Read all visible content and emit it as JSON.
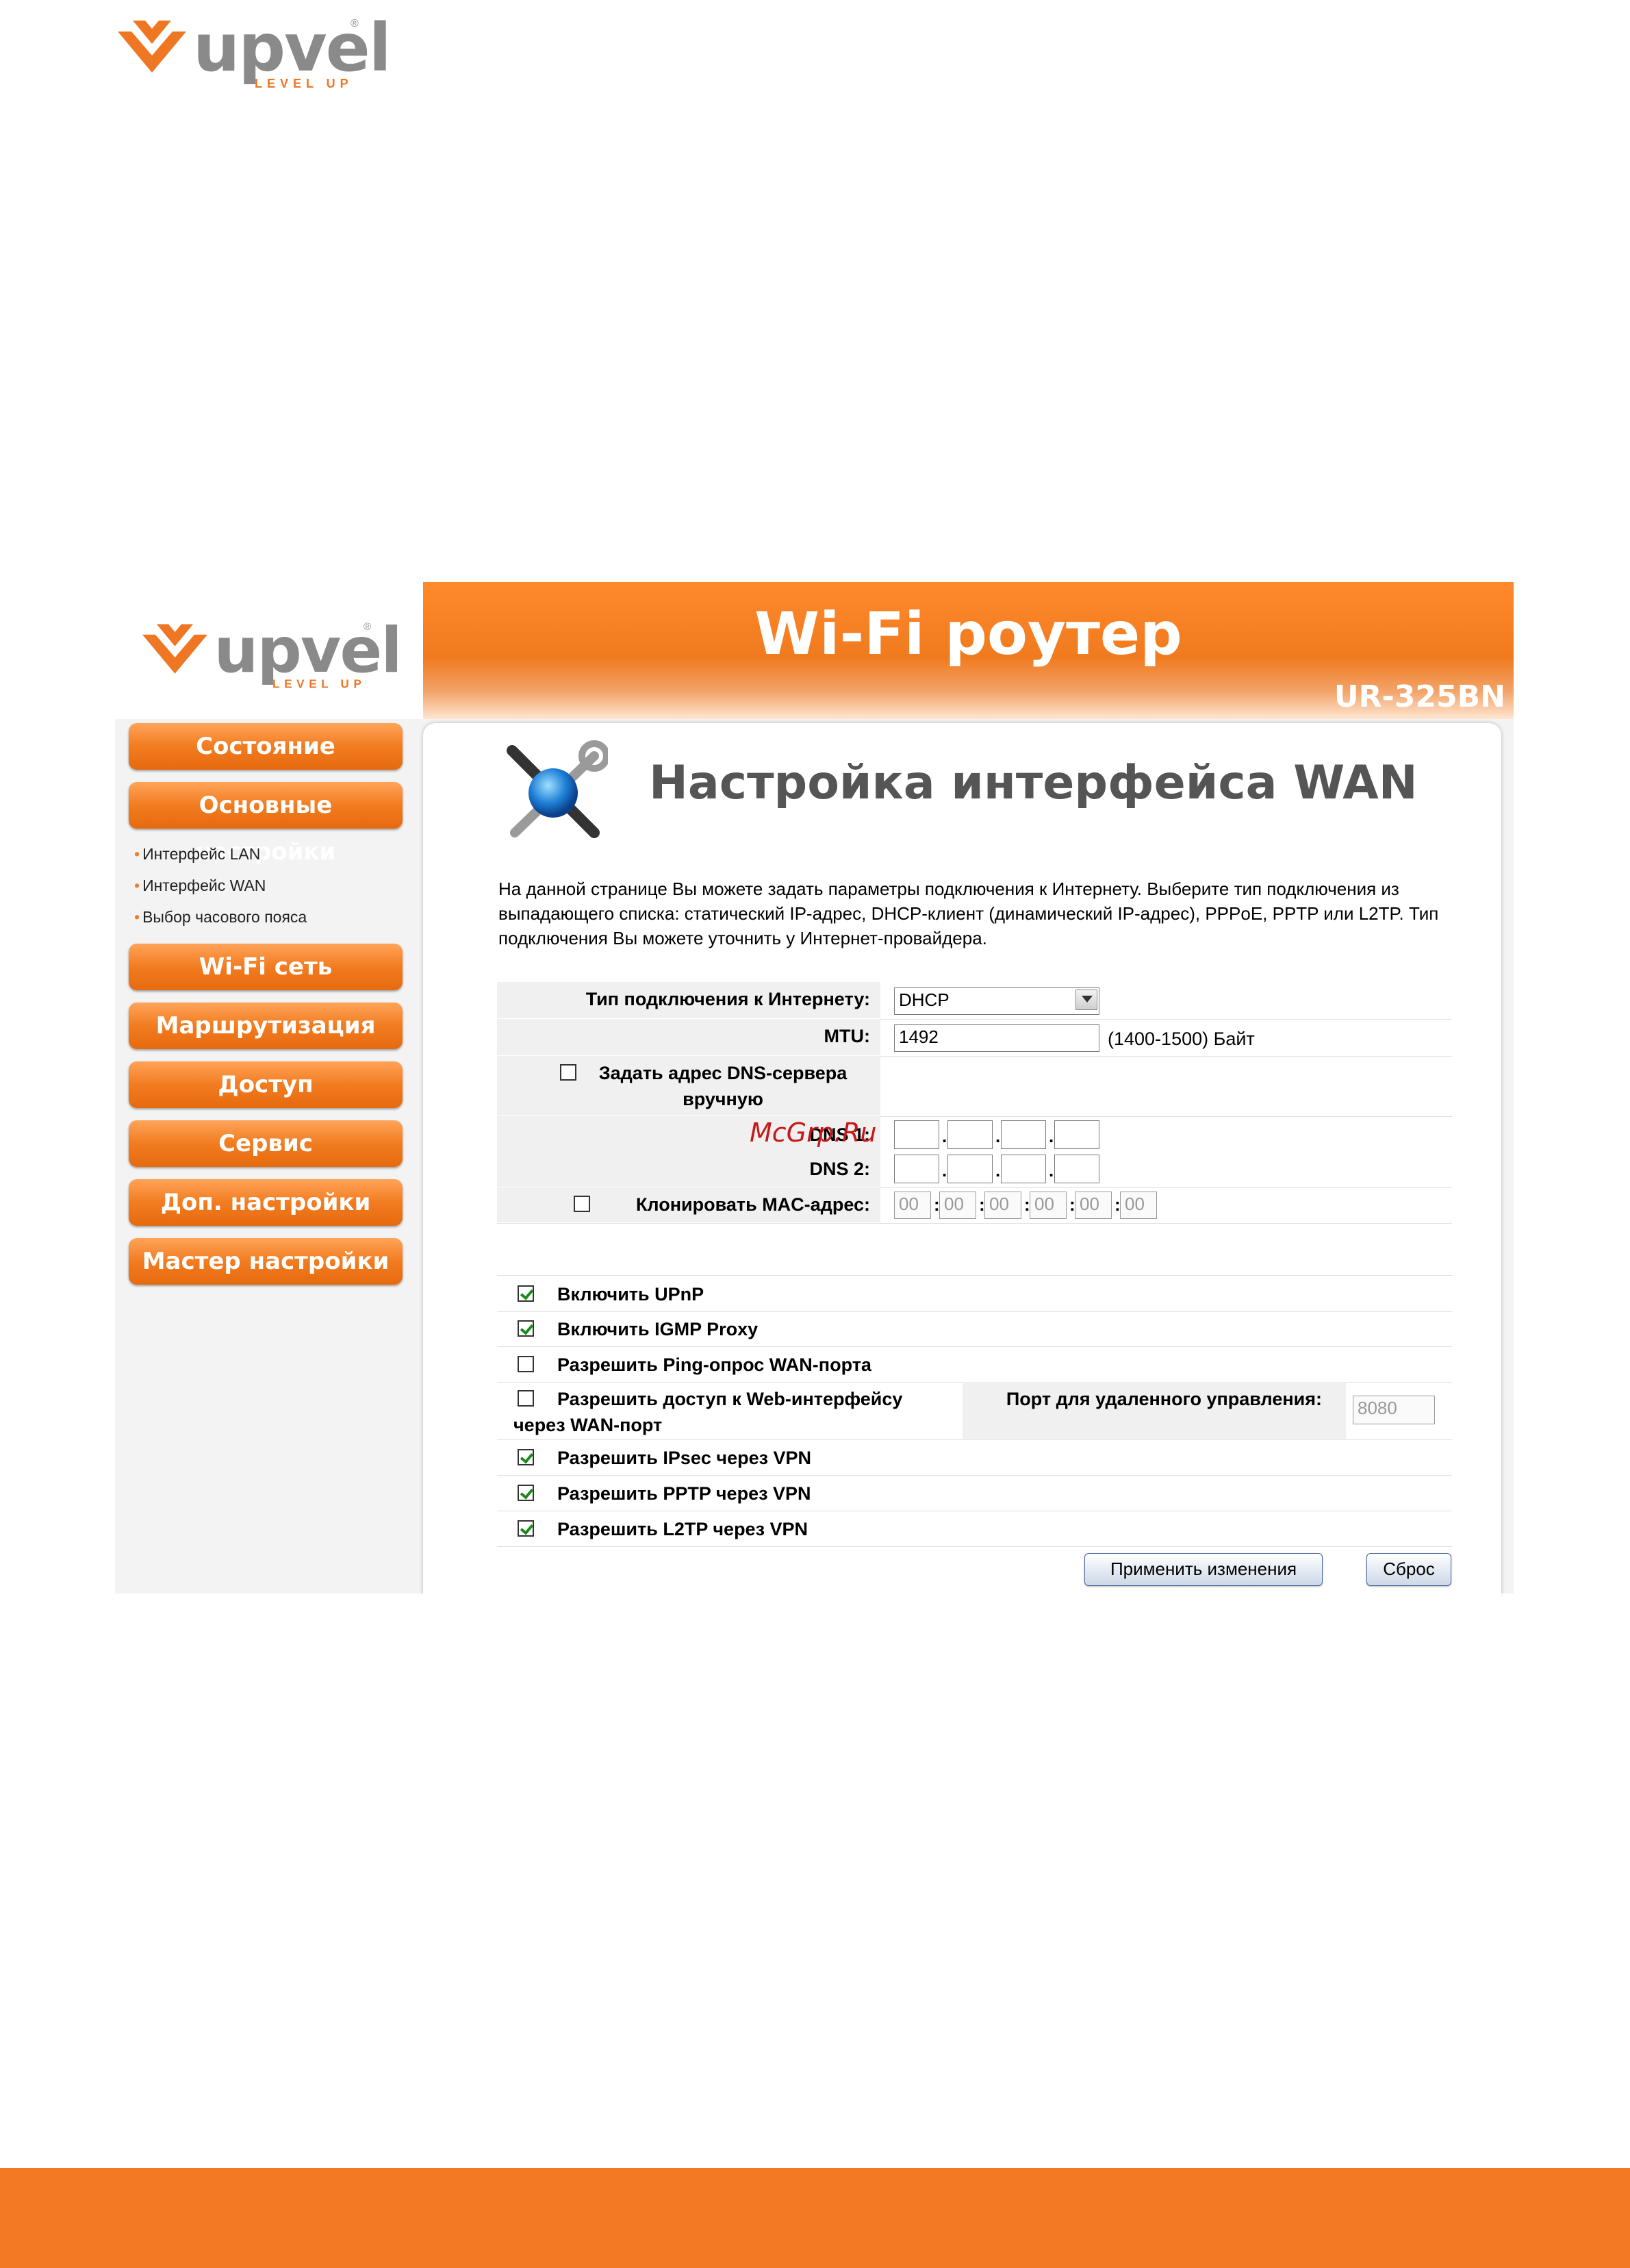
{
  "brand": {
    "name": "upvel",
    "tagline": "LEVEL UP",
    "registered": "®"
  },
  "header": {
    "title": "Wi-Fi роутер",
    "model": "UR-325BN"
  },
  "sidebar": {
    "items": [
      {
        "label": "Состояние"
      },
      {
        "label": "Основные настройки"
      },
      {
        "label": "Wi-Fi сеть"
      },
      {
        "label": "Маршрутизация"
      },
      {
        "label": "Доступ"
      },
      {
        "label": "Сервис"
      },
      {
        "label": "Доп. настройки"
      },
      {
        "label": "Мастер настройки"
      }
    ],
    "subitems": [
      {
        "label": "Интерфейс LAN"
      },
      {
        "label": "Интерфейс WAN"
      },
      {
        "label": "Выбор часового пояса"
      }
    ]
  },
  "main": {
    "title": "Настройка интерфейса WAN",
    "description": "На данной странице Вы можете задать параметры подключения к Интернету. Выберите тип подключения из выпадающего списка: статический IP-адрес, DHCP-клиент (динамический IP-адрес), PPPoE, PPTP или L2TP. Тип подключения Вы можете уточнить у Интернет-провайдера."
  },
  "form": {
    "connection_type_label": "Тип подключения к Интернету:",
    "connection_type_value": "DHCP",
    "mtu_label": "MTU:",
    "mtu_value": "1492",
    "mtu_hint": "(1400-1500) Байт",
    "dns_manual_label": "Задать адрес DNS-сервера вручную",
    "dns_manual_checked": false,
    "dns1_label": "DNS 1:",
    "dns2_label": "DNS 2:",
    "clone_mac_label": "Клонировать MAC-адрес:",
    "clone_mac_checked": false,
    "mac_octets": [
      "00",
      "00",
      "00",
      "00",
      "00",
      "00"
    ],
    "remote_port_label": "Порт для удаленного управления:",
    "remote_port_value": "8080"
  },
  "options": [
    {
      "label": "Включить UPnP",
      "checked": true
    },
    {
      "label": "Включить IGMP Proxy",
      "checked": true
    },
    {
      "label": "Разрешить Ping-опрос WAN-порта",
      "checked": false
    },
    {
      "label": "Разрешить доступ к Web-интерфейсу через WAN-порт",
      "checked": false
    },
    {
      "label": "Разрешить IPsec через VPN",
      "checked": true
    },
    {
      "label": "Разрешить PPTP через VPN",
      "checked": true
    },
    {
      "label": "Разрешить L2TP через VPN",
      "checked": true
    }
  ],
  "buttons": {
    "apply": "Применить изменения",
    "reset": "Сброс"
  },
  "watermark": "McGrp.Ru",
  "colors": {
    "accent": "#f27a25",
    "title_gray": "#555555"
  }
}
